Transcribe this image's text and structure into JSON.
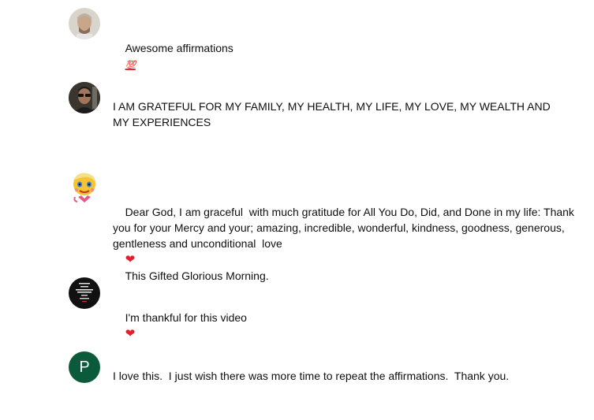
{
  "comments": [
    {
      "text": "Awesome affirmations",
      "emoji": "💯",
      "avatar": "photo-avatar-man"
    },
    {
      "text": "I AM GRATEFUL FOR MY FAMILY, MY HEALTH, MY LIFE, MY LOVE, MY WEALTH AND MY EXPERIENCES",
      "avatar": "photo-avatar-sunglasses"
    },
    {
      "text_a": "Dear God, I am graceful  with much gratitude for All You Do, Did, and Done in my life: Thank you for your Mercy and your; amazing, incredible, wonderful, kindness, goodness, generous, gentleness and unconditional  love",
      "heart": "❤",
      "text_b": "This Gifted Glorious Morning.",
      "avatar": "emoji-avatar"
    },
    {
      "text": "I'm thankful for this video",
      "heart": "❤",
      "avatar": "poster-avatar"
    },
    {
      "text": "I love this.  I just wish there was more time to repeat the affirmations.  Thank you.",
      "avatar_letter": "P",
      "avatar_color": "#0b5a3c"
    }
  ]
}
